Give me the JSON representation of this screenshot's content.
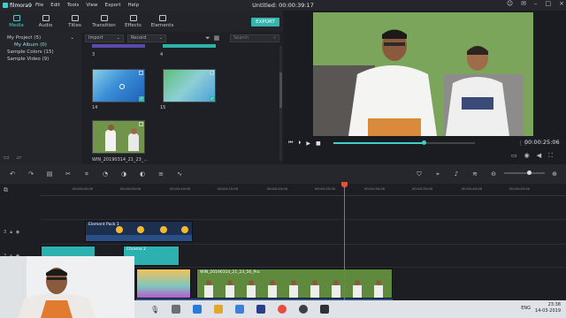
{
  "app": {
    "logo": "filmora9",
    "menu": [
      "File",
      "Edit",
      "Tools",
      "View",
      "Export",
      "Help"
    ],
    "title": "Untitled:",
    "title_time": "00:00:39:17"
  },
  "library_tabs": [
    {
      "label": "Media",
      "icon": "film-icon"
    },
    {
      "label": "Audio",
      "icon": "music-icon"
    },
    {
      "label": "Titles",
      "icon": "text-icon"
    },
    {
      "label": "Transition",
      "icon": "transition-icon"
    },
    {
      "label": "Effects",
      "icon": "effects-icon"
    },
    {
      "label": "Elements",
      "icon": "elements-icon"
    }
  ],
  "export_label": "EXPORT",
  "sidebar": {
    "items": [
      {
        "label": "My Project (5)"
      },
      {
        "label": "My Album (0)"
      },
      {
        "label": "Sample Colors (15)"
      },
      {
        "label": "Sample Video (9)"
      }
    ]
  },
  "library_toolbar": {
    "import_label": "Import",
    "record_label": "Record",
    "search_placeholder": "Search"
  },
  "media_items": [
    {
      "label": "3"
    },
    {
      "label": "4"
    },
    {
      "label": "14"
    },
    {
      "label": "15"
    },
    {
      "label": "WIN_20190314_21_23_..."
    }
  ],
  "preview": {
    "timecode": "00:00:25:06",
    "progress": 0.64
  },
  "ruler": {
    "labels": [
      "00:00:00:00",
      "00:00:05:00",
      "00:00:10:00",
      "00:00:15:00",
      "00:00:20:00",
      "00:00:25:00",
      "00:00:30:00",
      "00:00:35:00",
      "00:00:40:00",
      "00:00:45:00",
      "00:00:50:00"
    ]
  },
  "tracks": {
    "element_clip": "Element Pack 1",
    "chroma_clip": "Chroma 2",
    "video_clip": "WIN_20190314_21_23_56_Pro",
    "track_labels": [
      "3",
      "2",
      "1"
    ]
  },
  "taskbar": {
    "lang": "ENG",
    "time": "23:38",
    "date": "14-03-2019"
  },
  "colors": {
    "accent": "#3fd1c7",
    "playhead": "#e0523f",
    "export_button": "#36b5ac"
  }
}
